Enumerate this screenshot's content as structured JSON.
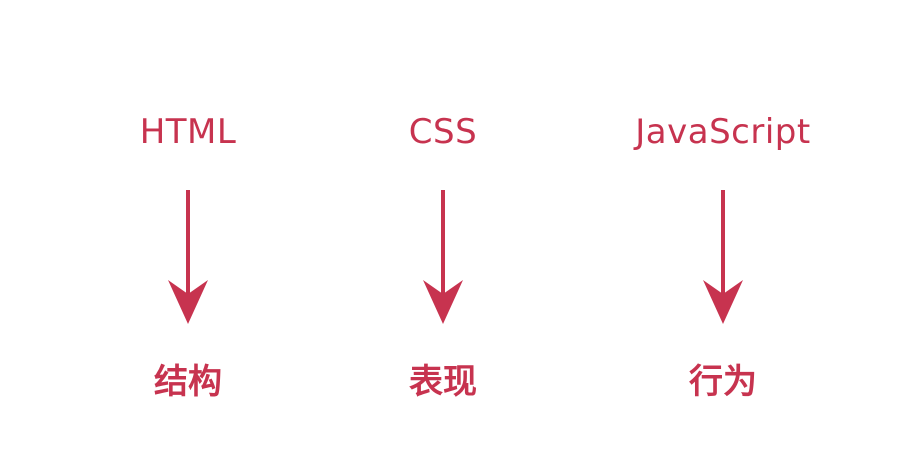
{
  "colors": {
    "accent": "#c7334f",
    "background": "#ffffff"
  },
  "columns": [
    {
      "tech": "HTML",
      "role": "结构",
      "icon": "arrow-down-icon"
    },
    {
      "tech": "CSS",
      "role": "表现",
      "icon": "arrow-down-icon"
    },
    {
      "tech": "JavaScript",
      "role": "行为",
      "icon": "arrow-down-icon"
    }
  ]
}
